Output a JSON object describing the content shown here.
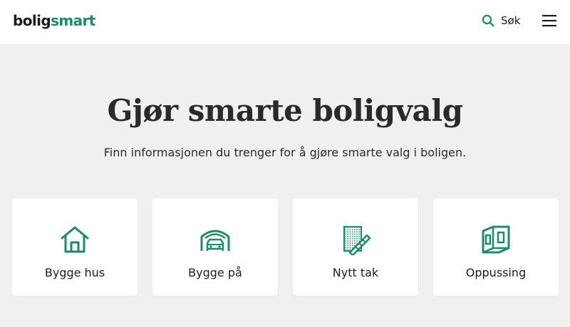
{
  "brand": {
    "logo_part1": "bolig",
    "logo_part2": "smart",
    "accent_color": "#1f8a68"
  },
  "header": {
    "search_label": "Søk",
    "search_icon": "search-icon",
    "menu_icon": "hamburger-menu-icon"
  },
  "hero": {
    "title": "Gjør smarte boligvalg",
    "subtitle": "Finn informasjonen du trenger for å gjøre smarte valg i boligen."
  },
  "categories": [
    {
      "label": "Bygge hus",
      "icon": "house-icon"
    },
    {
      "label": "Bygge på",
      "icon": "garage-icon"
    },
    {
      "label": "Nytt tak",
      "icon": "roof-icon"
    },
    {
      "label": "Oppussing",
      "icon": "room-renovation-icon"
    }
  ]
}
